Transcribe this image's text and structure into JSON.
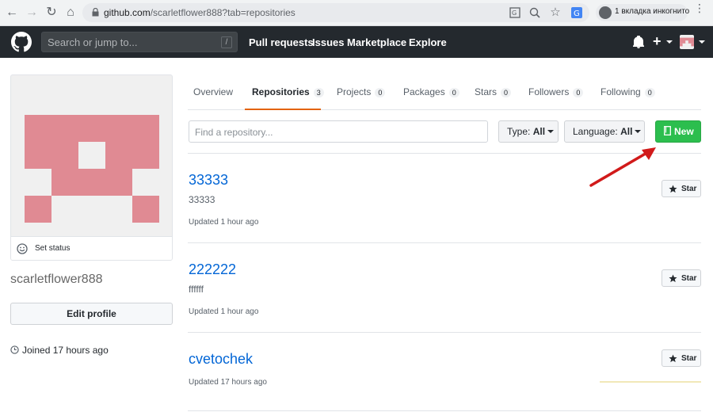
{
  "browser": {
    "url_host": "github.com",
    "url_path": "/scarletflower888?tab=repositories",
    "incognito_label": "1 вкладка инкогнито"
  },
  "header": {
    "search_placeholder": "Search or jump to...",
    "search_shortcut": "/",
    "nav": [
      "Pull requests",
      "Issues",
      "Marketplace",
      "Explore"
    ],
    "plus_icon": "+",
    "bell_icon": "bell-icon"
  },
  "profile": {
    "set_status": "Set status",
    "username": "scarletflower888",
    "edit_profile": "Edit profile",
    "joined": "Joined 17 hours ago",
    "identicon_color": "#e08a93"
  },
  "tabs": [
    {
      "label": "Overview",
      "count": ""
    },
    {
      "label": "Repositories",
      "count": "3"
    },
    {
      "label": "Projects",
      "count": "0"
    },
    {
      "label": "Packages",
      "count": "0"
    },
    {
      "label": "Stars",
      "count": "0"
    },
    {
      "label": "Followers",
      "count": "0"
    },
    {
      "label": "Following",
      "count": "0"
    }
  ],
  "filters": {
    "find_placeholder": "Find a repository...",
    "type_label": "Type:",
    "type_value": "All",
    "language_label": "Language:",
    "language_value": "All",
    "new_label": "New"
  },
  "repos": [
    {
      "name": "33333",
      "description": "33333",
      "updated": "Updated 1 hour ago",
      "star_label": "Star"
    },
    {
      "name": "222222",
      "description": "ffffff",
      "updated": "Updated 1 hour ago",
      "star_label": "Star"
    },
    {
      "name": "cvetochek",
      "description": "",
      "updated": "Updated 17 hours ago",
      "star_label": "Star"
    }
  ],
  "colors": {
    "accent_tab": "#e36209",
    "new_button": "#2cbe4e",
    "link": "#0366d6",
    "annotation_arrow": "#d11a1a"
  }
}
